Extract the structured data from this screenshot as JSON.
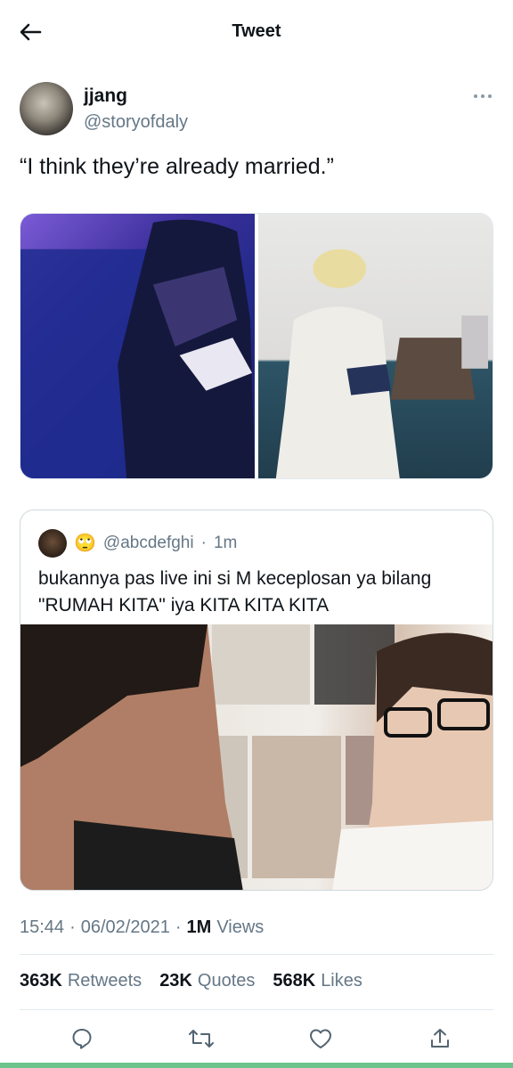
{
  "header": {
    "title": "Tweet"
  },
  "author": {
    "name": "jjang",
    "handle": "@storyofdaly"
  },
  "tweet": {
    "text": "“I think they’re already married.”"
  },
  "quote": {
    "emoji": "🙄",
    "handle": "@abcdefghi",
    "separator": "·",
    "time": "1m",
    "text": "bukannya pas live ini si M keceplosan ya bilang \"RUMAH KITA\" iya KITA KITA KITA"
  },
  "meta": {
    "time": "15:44",
    "sep1": "·",
    "date": "06/02/2021",
    "sep2": "·",
    "views_count": "1M",
    "views_label": "Views"
  },
  "stats": [
    {
      "num": "363K",
      "label": "Retweets"
    },
    {
      "num": "23K",
      "label": "Quotes"
    },
    {
      "num": "568K",
      "label": "Likes"
    }
  ],
  "icons": {
    "back": "arrow-left-icon",
    "more": "more-horizontal-icon",
    "reply": "reply-icon",
    "retweet": "retweet-icon",
    "like": "heart-icon",
    "share": "share-icon"
  },
  "colors": {
    "text": "#0f1419",
    "secondary": "#657786",
    "border": "#e1e8ed"
  }
}
